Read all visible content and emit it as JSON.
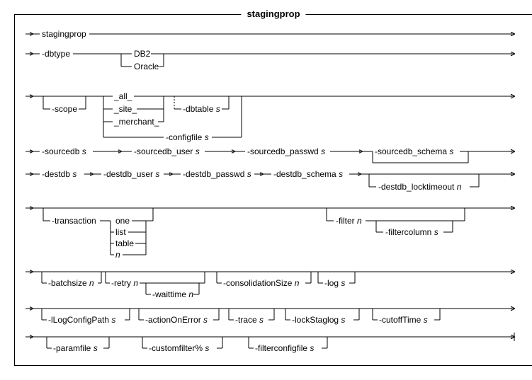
{
  "title": "stagingprop",
  "cmd": "stagingprop",
  "flags": {
    "dbtype": "-dbtype",
    "dbtype_opts": [
      "DB2",
      "Oracle"
    ],
    "scope": "-scope",
    "scope_opts": [
      "_all_",
      "_site_",
      "_merchant_"
    ],
    "dbtable": "-dbtable",
    "configfile": "-configfile",
    "sourcedb": "-sourcedb",
    "sourcedb_user": "-sourcedb_user",
    "sourcedb_passwd": "-sourcedb_passwd",
    "sourcedb_schema": "-sourcedb_schema",
    "destdb": "-destdb",
    "destdb_user": "-destdb_user",
    "destdb_passwd": "-destdb_passwd",
    "destdb_schema": "-destdb_schema",
    "destdb_locktimeout": "-destdb_locktimeout",
    "transaction": "-transaction",
    "transaction_opts": [
      "one",
      "list",
      "table"
    ],
    "filter": "-filter",
    "filtercolumn": "-filtercolumn",
    "batchsize": "-batchsize",
    "retry": "-retry",
    "waittime": "-waittime",
    "consolidationSize": "-consolidationSize",
    "log": "-log",
    "lLogConfigPath": "-lLogConfigPath",
    "actionOnError": "-actionOnError",
    "trace": "-trace",
    "lockStaglog": "-lockStaglog",
    "cutoffTime": "-cutoffTime",
    "paramfile": "-paramfile",
    "customfilter": "-customfilter%",
    "filterconfigfile": "-filterconfigfile"
  },
  "vars": {
    "s": "s",
    "n": "n"
  },
  "chart_data": {
    "type": "syntax-railroad",
    "command": "stagingprop",
    "sequence": [
      {
        "token": "stagingprop",
        "required": true
      },
      {
        "flag": "-dbtype",
        "required": true,
        "choices": [
          "DB2",
          "Oracle"
        ]
      },
      {
        "flag": "-scope",
        "required": false,
        "branch": [
          {
            "choices": [
              "_all_",
              "_site_",
              "_merchant_"
            ],
            "then_optional": {
              "flag": "-dbtable",
              "arg": "s"
            }
          },
          {
            "flag": "-configfile",
            "arg": "s"
          }
        ]
      },
      {
        "flag": "-sourcedb",
        "arg": "s",
        "required": true
      },
      {
        "flag": "-sourcedb_user",
        "arg": "s",
        "required": true
      },
      {
        "flag": "-sourcedb_passwd",
        "arg": "s",
        "required": true
      },
      {
        "flag": "-sourcedb_schema",
        "arg": "s",
        "required": false
      },
      {
        "flag": "-destdb",
        "arg": "s",
        "required": true
      },
      {
        "flag": "-destdb_user",
        "arg": "s",
        "required": true
      },
      {
        "flag": "-destdb_passwd",
        "arg": "s",
        "required": true
      },
      {
        "flag": "-destdb_schema",
        "arg": "s",
        "required": true
      },
      {
        "flag": "-destdb_locktimeout",
        "arg": "n",
        "required": false
      },
      {
        "flag": "-transaction",
        "required": false,
        "choices": [
          "one",
          "list",
          "table",
          "n"
        ]
      },
      {
        "group_optional": [
          {
            "flag": "-filter",
            "arg": "n"
          },
          {
            "flag": "-filtercolumn",
            "arg": "s",
            "required": false
          }
        ]
      },
      {
        "flag": "-batchsize",
        "arg": "n",
        "required": false
      },
      {
        "flag": "-retry",
        "arg": "n",
        "required": false,
        "nested_optional": {
          "flag": "-waittime",
          "arg": "n"
        }
      },
      {
        "flag": "-consolidationSize",
        "arg": "n",
        "required": false
      },
      {
        "flag": "-log",
        "arg": "s",
        "required": false
      },
      {
        "flag": "-lLogConfigPath",
        "arg": "s",
        "required": false
      },
      {
        "flag": "-actionOnError",
        "arg": "s",
        "required": false
      },
      {
        "flag": "-trace",
        "arg": "s",
        "required": false
      },
      {
        "flag": "-lockStaglog",
        "arg": "s",
        "required": false
      },
      {
        "flag": "-cutoffTime",
        "arg": "s",
        "required": false
      },
      {
        "flag": "-paramfile",
        "arg": "s",
        "required": false
      },
      {
        "flag": "-customfilter%",
        "arg": "s",
        "required": false
      },
      {
        "flag": "-filterconfigfile",
        "arg": "s",
        "required": false
      }
    ]
  }
}
